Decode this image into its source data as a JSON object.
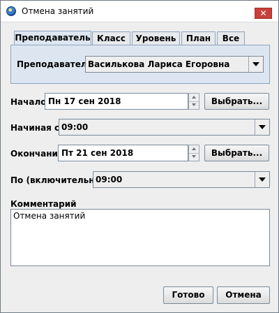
{
  "window": {
    "title": "Отмена занятий",
    "close_glyph": "✕",
    "app_icon": "app-globe-icon"
  },
  "tabs": [
    {
      "label": "Преподаватель",
      "active": true
    },
    {
      "label": "Класс",
      "active": false
    },
    {
      "label": "Уровень",
      "active": false
    },
    {
      "label": "План",
      "active": false
    },
    {
      "label": "Все",
      "active": false
    }
  ],
  "teacher": {
    "label": "Преподаватель",
    "value": "Василькова Лариса Егоровна"
  },
  "start": {
    "label": "Начало",
    "date": "Пн 17 сен 2018",
    "choose_label": "Выбрать..."
  },
  "start_time": {
    "label": "Начиная с",
    "value": "09:00"
  },
  "end": {
    "label": "Окончание",
    "date": "Пт 21 сен 2018",
    "choose_label": "Выбрать..."
  },
  "end_time": {
    "label": "По (включительно)",
    "value": "09:00"
  },
  "comment": {
    "label": "Комментарий",
    "value": "Отмена занятий"
  },
  "footer": {
    "ok_label": "Готово",
    "cancel_label": "Отмена"
  }
}
